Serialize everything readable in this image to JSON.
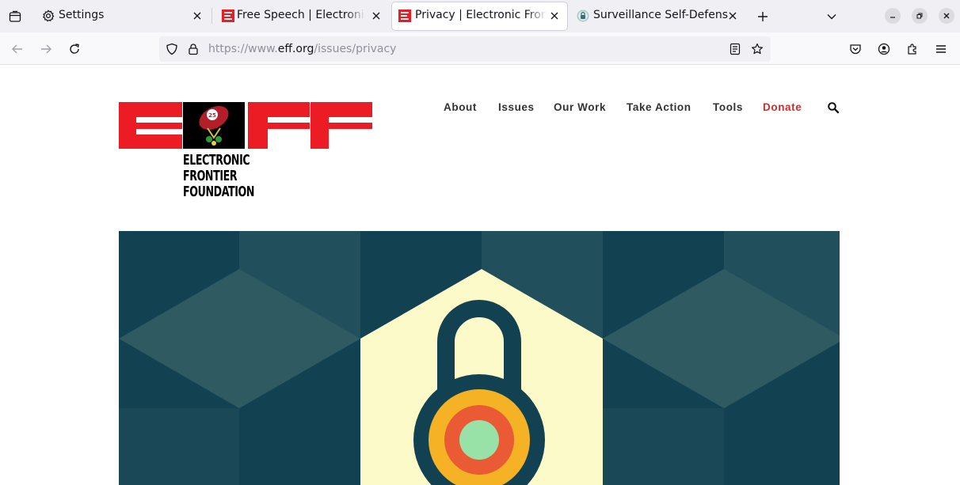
{
  "browser": {
    "tabs": [
      {
        "title": "Settings",
        "favicon": "gear-icon",
        "active": false
      },
      {
        "title": "Free Speech | Electronic Frontier Foundation",
        "favicon": "eff-favicon",
        "active": false
      },
      {
        "title": "Privacy | Electronic Frontier Foundation",
        "favicon": "eff-favicon",
        "active": true
      },
      {
        "title": "Surveillance Self-Defense",
        "favicon": "ssd-lock-favicon",
        "active": false
      }
    ],
    "url_prefix": "https://www.",
    "url_host": "eff.org",
    "url_path": "/issues/privacy"
  },
  "site": {
    "logo_text": [
      "ELECTRONIC",
      "FRONTIER",
      "FOUNDATION"
    ],
    "nav": [
      {
        "label": "About"
      },
      {
        "label": "Issues"
      },
      {
        "label": "Our Work"
      },
      {
        "label": "Take Action"
      },
      {
        "label": "Tools"
      },
      {
        "label": "Donate"
      }
    ]
  },
  "colors": {
    "eff_red": "#ec1c24",
    "donate_red": "#d32b2b",
    "hero_dark": "#124252",
    "hero_mid": "#224f5c",
    "hero_light": "#2f5a62",
    "hex_cream": "#fbfac8",
    "lock_outer": "#f5b224",
    "lock_mid": "#e95a35",
    "lock_inner": "#98e2a8"
  }
}
